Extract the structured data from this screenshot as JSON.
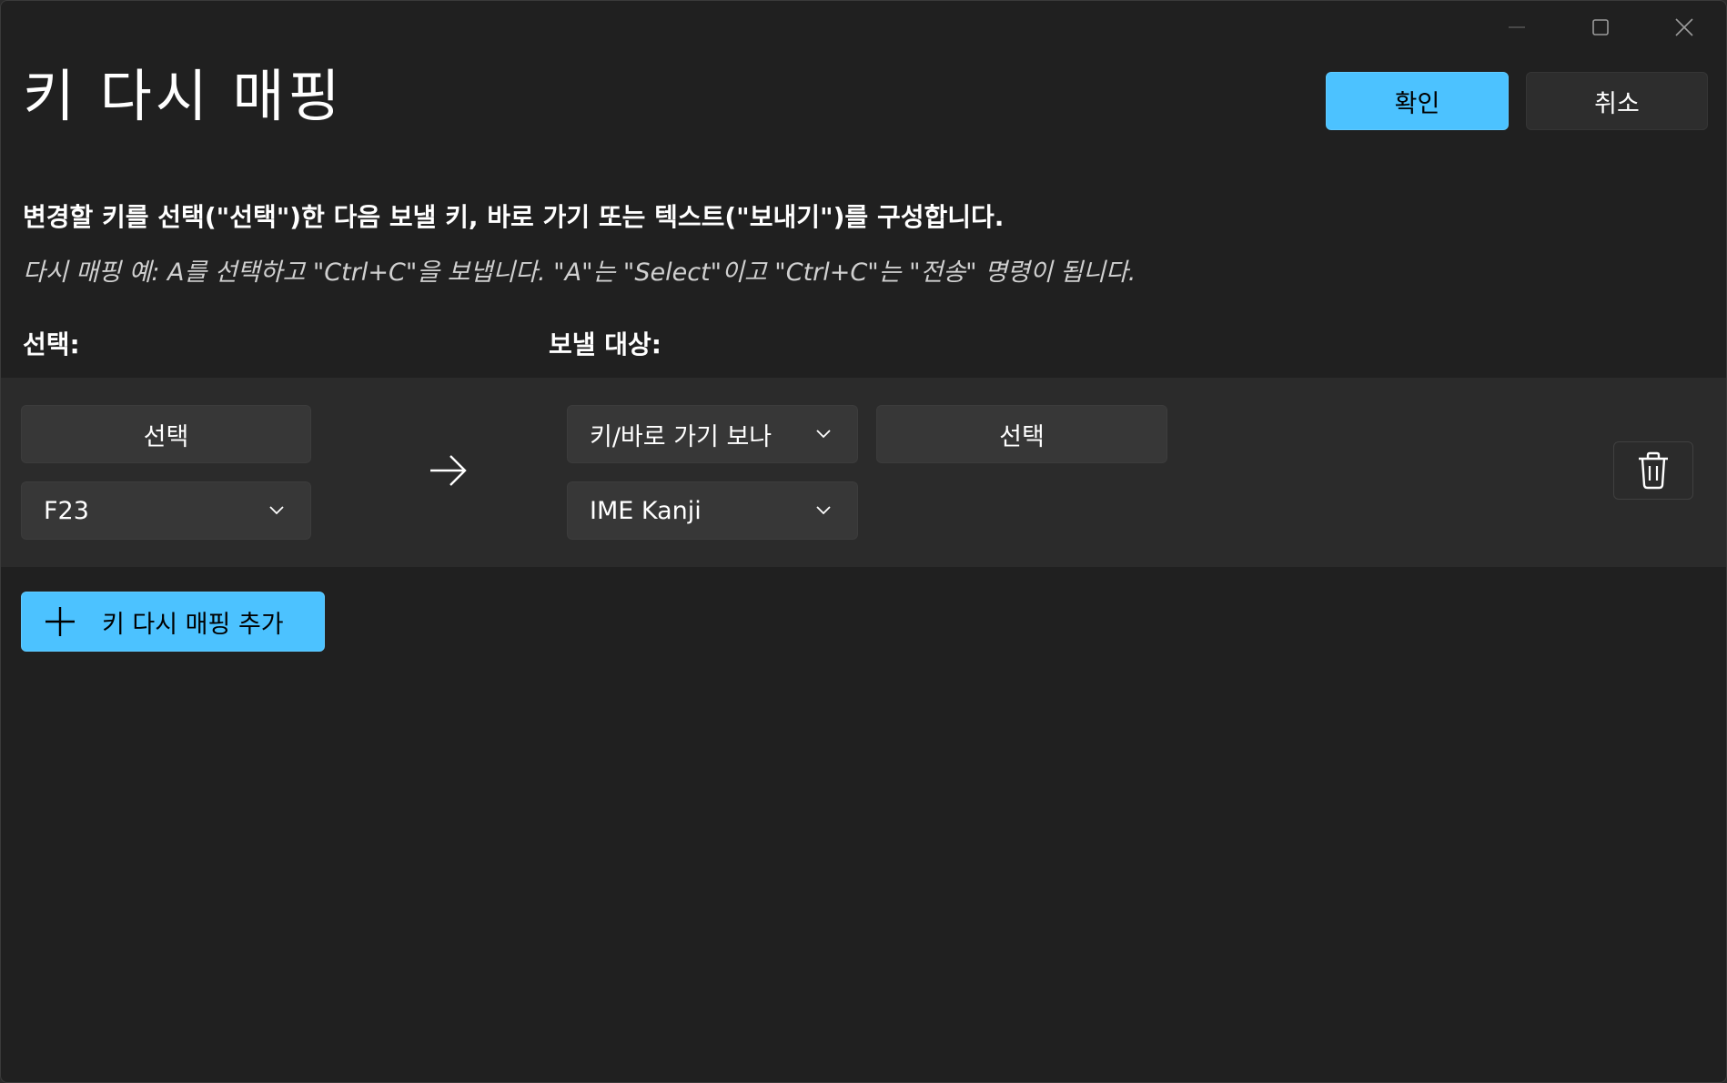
{
  "window": {
    "title": "키 다시 매핑",
    "controls": [
      "minimize-icon",
      "maximize-icon",
      "close-icon"
    ]
  },
  "header": {
    "confirm_label": "확인",
    "cancel_label": "취소"
  },
  "instructions": {
    "main": "변경할 키를 선택(\"선택\")한 다음 보낼 키, 바로 가기 또는 텍스트(\"보내기\")를 구성합니다.",
    "example": "다시 매핑 예: A를 선택하고 \"Ctrl+C\"을 보냅니다. \"A\"는 \"Select\"이고 \"Ctrl+C\"는 \"전송\" 명령이 됩니다."
  },
  "columns": {
    "select_label": "선택:",
    "send_label": "보낼 대상:"
  },
  "mapping": {
    "source_select_label": "선택",
    "source_key": "F23",
    "target_type": "키/바로 가기 보나",
    "target_select_label": "선택",
    "target_key": "IME Kanji"
  },
  "footer": {
    "add_label": "키 다시 매핑 추가"
  },
  "colors": {
    "accent": "#4cc2ff",
    "background": "#202020",
    "row_background": "#2b2b2b",
    "control": "#373737"
  }
}
